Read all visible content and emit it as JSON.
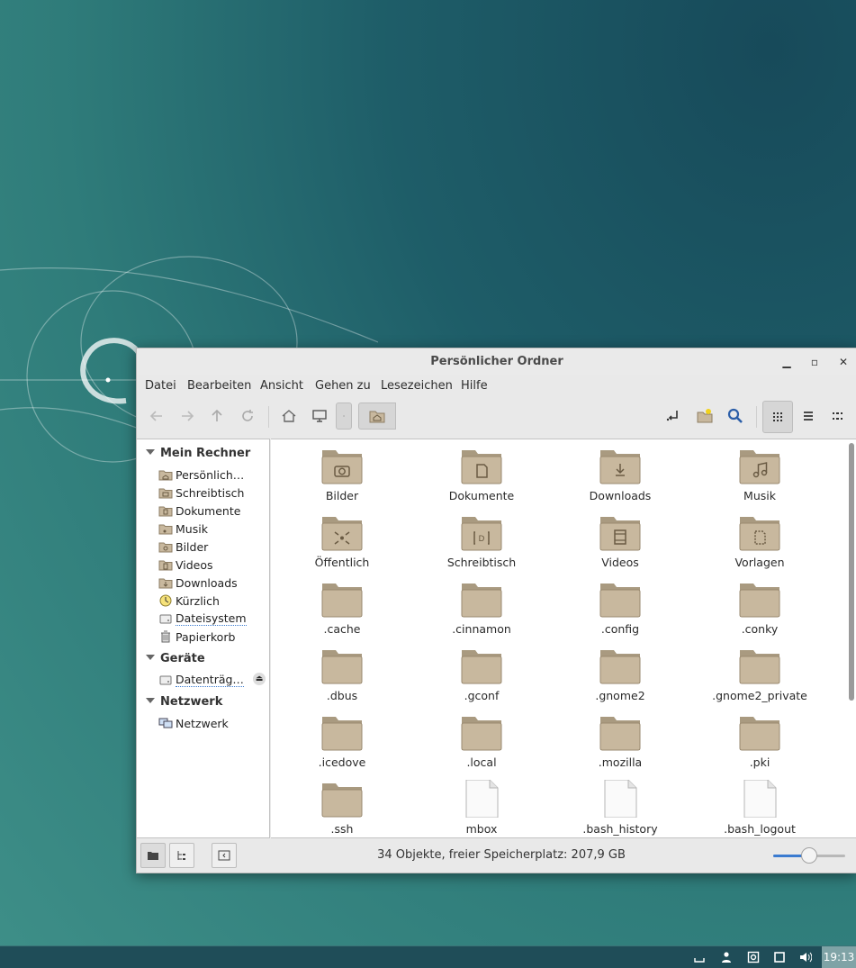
{
  "window": {
    "title": "Persönlicher Ordner",
    "controls": [
      "minimize-icon",
      "maximize-icon",
      "close-icon"
    ]
  },
  "menubar": [
    "Datei",
    "Bearbeiten",
    "Ansicht",
    "Gehen zu",
    "Lesezeichen",
    "Hilfe"
  ],
  "toolbar": {
    "buttons": [
      "back-icon",
      "forward-icon",
      "up-icon",
      "reload-icon",
      "home-icon",
      "computer-icon"
    ],
    "right_buttons": [
      "open-terminal-icon",
      "new-folder-icon",
      "search-icon"
    ],
    "view_buttons": [
      "icon-view-icon",
      "list-view-icon",
      "compact-view-icon"
    ],
    "active_view": "icon-view"
  },
  "sidebar": {
    "sections": [
      {
        "title": "Mein Rechner",
        "items": [
          "Persönlich…",
          "Schreibtisch",
          "Dokumente",
          "Musik",
          "Bilder",
          "Videos",
          "Downloads",
          "Kürzlich",
          "Dateisystem",
          "Papierkorb"
        ]
      },
      {
        "title": "Geräte",
        "items": [
          "Datenträg…"
        ]
      },
      {
        "title": "Netzwerk",
        "items": [
          "Netzwerk"
        ]
      }
    ]
  },
  "files": [
    {
      "name": "Bilder",
      "icon": "folder-pictures-icon"
    },
    {
      "name": "Dokumente",
      "icon": "folder-documents-icon"
    },
    {
      "name": "Downloads",
      "icon": "folder-downloads-icon"
    },
    {
      "name": "Musik",
      "icon": "folder-music-icon"
    },
    {
      "name": "Öffentlich",
      "icon": "folder-public-icon"
    },
    {
      "name": "Schreibtisch",
      "icon": "folder-desktop-icon"
    },
    {
      "name": "Videos",
      "icon": "folder-videos-icon"
    },
    {
      "name": "Vorlagen",
      "icon": "folder-templates-icon"
    },
    {
      "name": ".cache",
      "icon": "folder-icon"
    },
    {
      "name": ".cinnamon",
      "icon": "folder-icon"
    },
    {
      "name": ".config",
      "icon": "folder-icon"
    },
    {
      "name": ".conky",
      "icon": "folder-icon"
    },
    {
      "name": ".dbus",
      "icon": "folder-icon"
    },
    {
      "name": ".gconf",
      "icon": "folder-icon"
    },
    {
      "name": ".gnome2",
      "icon": "folder-icon"
    },
    {
      "name": ".gnome2_private",
      "icon": "folder-icon"
    },
    {
      "name": ".icedove",
      "icon": "folder-icon"
    },
    {
      "name": ".local",
      "icon": "folder-icon"
    },
    {
      "name": ".mozilla",
      "icon": "folder-icon"
    },
    {
      "name": ".pki",
      "icon": "folder-icon"
    },
    {
      "name": ".ssh",
      "icon": "folder-icon"
    },
    {
      "name": "mbox",
      "icon": "file-icon"
    },
    {
      "name": ".bash_history",
      "icon": "file-icon"
    },
    {
      "name": ".bash_logout",
      "icon": "file-icon"
    }
  ],
  "statusbar": {
    "text": "34 Objekte, freier Speicherplatz: 207,9 GB",
    "zoom_fraction": 0.5
  },
  "panel": {
    "tray": [
      "workspace-icon",
      "user-icon",
      "update-icon",
      "window-icon",
      "volume-icon"
    ],
    "clock": "19:13"
  },
  "colors": {
    "folder": "#c8b89e",
    "accent": "#3a7bd0"
  }
}
